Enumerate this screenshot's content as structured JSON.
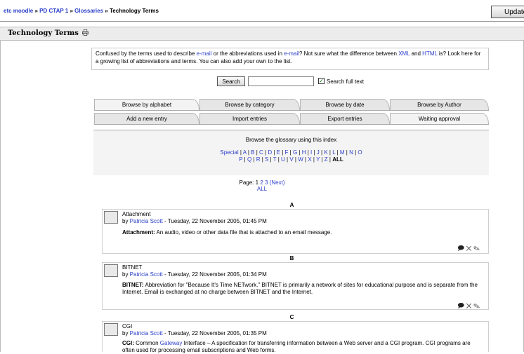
{
  "breadcrumb": {
    "site": "etc moodle",
    "course": "PD CTAP 1",
    "module": "Glossaries",
    "current": "Technology Terms",
    "separator": "»"
  },
  "update_button": "Update",
  "page": {
    "title": "Technology Terms",
    "icon": "printer-icon"
  },
  "intro": {
    "p1": "Confused by the terms used to describe ",
    "link1": "e-mail",
    "p2": " or the abbreviations used in ",
    "link2": "e-mail",
    "p3": "? Not sure what the difference between ",
    "link3": "XML",
    "p4": " and ",
    "link4": "HTML",
    "p5": " is? Look here for a growing list of abbreviations and terms. You can also add your own to the list."
  },
  "search": {
    "button": "Search",
    "value": "",
    "fulltext_label": "Search full text",
    "fulltext_checked": true
  },
  "tabs_row1": [
    "Browse by alphabet",
    "Browse by category",
    "Browse by date",
    "Browse by Author"
  ],
  "tabs_row2": [
    "Add a new entry",
    "Import entries",
    "Export entries",
    "Waiting approval"
  ],
  "browse": {
    "hint": "Browse the glossary using this index",
    "row1": [
      "Special",
      "A",
      "B",
      "C",
      "D",
      "E",
      "F",
      "G",
      "H",
      "I",
      "J",
      "K",
      "L",
      "M",
      "N",
      "O"
    ],
    "row2": [
      "P",
      "Q",
      "R",
      "S",
      "T",
      "U",
      "V",
      "W",
      "X",
      "Y",
      "Z"
    ],
    "all": "ALL"
  },
  "pagination": {
    "label": "Page:",
    "current": "1",
    "pages": [
      "2",
      "3"
    ],
    "next": "(Next)",
    "all": "ALL"
  },
  "entries": [
    {
      "letter": "A",
      "term": "Attachment",
      "by": "by ",
      "author": "Patricia Scott",
      "date": " - Tuesday, 22 November 2005, 01:45 PM",
      "def_term": "Attachment:",
      "def_pre": " An audio, video or other data file that is attached to an email message.",
      "def_link": "",
      "def_post": ""
    },
    {
      "letter": "B",
      "term": "BITNET",
      "by": "by ",
      "author": "Patricia Scott",
      "date": " - Tuesday, 22 November 2005, 01:34 PM",
      "def_term": "BITNET:",
      "def_pre": " Abbreviation for \"Because It's Time NETwork.\" BITNET is primarily a network of sites for educational purpose and is separate from the Internet. Email is exchanged at no charge between BITNET and the Internet.",
      "def_link": "",
      "def_post": ""
    },
    {
      "letter": "C",
      "term": "CGI",
      "by": "by ",
      "author": "Patricia Scott",
      "date": " - Tuesday, 22 November 2005, 01:35 PM",
      "def_term": "CGI:",
      "def_pre": " Common ",
      "def_link": "Gateway",
      "def_post": " Interface – A specification for transferring information between a Web server and a CGI program. CGI programs are often used for processing email subscriptions and Web forms."
    }
  ]
}
